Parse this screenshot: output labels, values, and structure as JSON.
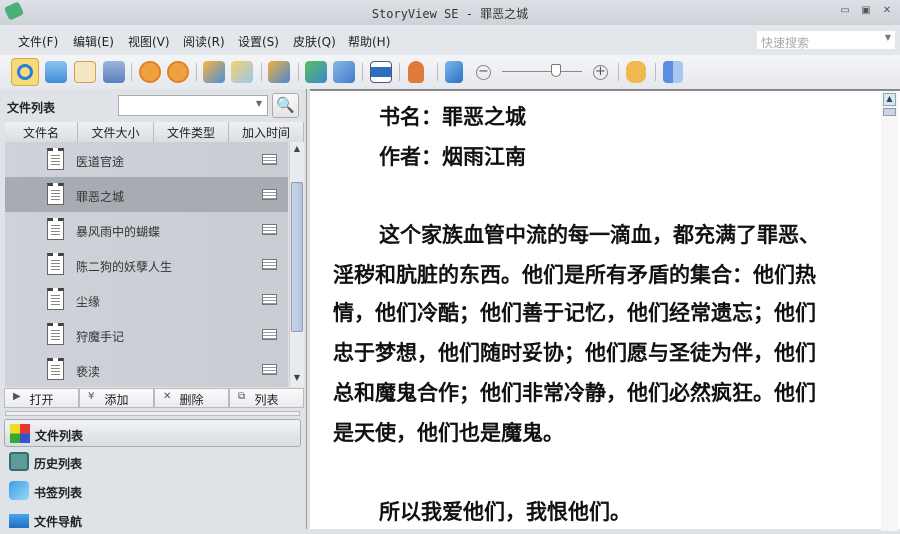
{
  "window": {
    "title": "StoryView SE - 罪恶之城",
    "min": "▭",
    "max": "▣",
    "close": "✕"
  },
  "menu": [
    "文件(F)",
    "编辑(E)",
    "视图(V)",
    "阅读(R)",
    "设置(S)",
    "皮肤(Q)",
    "帮助(H)"
  ],
  "quick_search": {
    "placeholder": "快速搜索"
  },
  "toolbar": {
    "zoom_minus": "−",
    "zoom_plus": "+",
    "zoom_level": 0.68
  },
  "file_panel": {
    "title": "文件列表",
    "columns": [
      "文件名",
      "文件大小",
      "文件类型",
      "加入时间"
    ],
    "files": [
      "医道官途",
      "罪恶之城",
      "暴风雨中的蝴蝶",
      "陈二狗的妖孽人生",
      "尘缘",
      "狩魔手记",
      "亵渎"
    ],
    "selected_index": 1,
    "actions": [
      {
        "icon": "▶",
        "label": "打开"
      },
      {
        "icon": "¥",
        "label": "添加"
      },
      {
        "icon": "✕",
        "label": "删除"
      },
      {
        "icon": "⧉",
        "label": "列表"
      }
    ]
  },
  "nav": [
    "文件列表",
    "历史列表",
    "书签列表",
    "文件导航"
  ],
  "reader": {
    "lines": [
      {
        "indent": true,
        "text": "书名：罪恶之城"
      },
      {
        "indent": true,
        "text": "作者：烟雨江南"
      },
      {
        "indent": true,
        "text": "这个家族血管中流的每一滴血，都充满了罪恶、"
      },
      {
        "indent": false,
        "text": "淫秽和肮脏的东西。他们是所有矛盾的集合：他们热"
      },
      {
        "indent": false,
        "text": "情，他们冷酷；他们善于记忆，他们经常遗忘；他们"
      },
      {
        "indent": false,
        "text": "忠于梦想，他们随时妥协；他们愿与圣徒为伴，他们"
      },
      {
        "indent": false,
        "text": "总和魔鬼合作；他们非常冷静，他们必然疯狂。他们"
      },
      {
        "indent": false,
        "text": "是天使，他们也是魔鬼。"
      },
      {
        "indent": true,
        "text": "所以我爱他们，我恨他们。"
      }
    ]
  }
}
